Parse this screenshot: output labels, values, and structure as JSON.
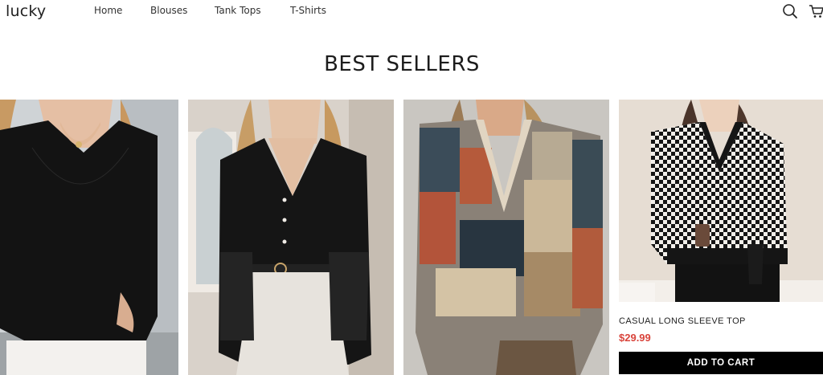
{
  "header": {
    "logo": "lucky",
    "nav": [
      {
        "label": "Home"
      },
      {
        "label": "Blouses"
      },
      {
        "label": "Tank Tops"
      },
      {
        "label": "T-Shirts"
      }
    ],
    "icons": [
      "search-icon",
      "cart-icon"
    ]
  },
  "section": {
    "title": "BEST SELLERS"
  },
  "products": [
    {
      "image": "black ribbed scoop-neck long sleeve top",
      "name": "",
      "price": ""
    },
    {
      "image": "black v-neck button blouse with lace sleeves",
      "name": "",
      "price": ""
    },
    {
      "image": "patchwork print v-neck long sleeve top",
      "name": "",
      "price": ""
    },
    {
      "image": "houndstooth v-neck sweater",
      "name": "CASUAL LONG SLEEVE TOP",
      "price": "$29.99",
      "cta": "ADD TO CART"
    }
  ],
  "colors": {
    "price": "#d9443b",
    "button_bg": "#000000",
    "button_text": "#ffffff"
  }
}
